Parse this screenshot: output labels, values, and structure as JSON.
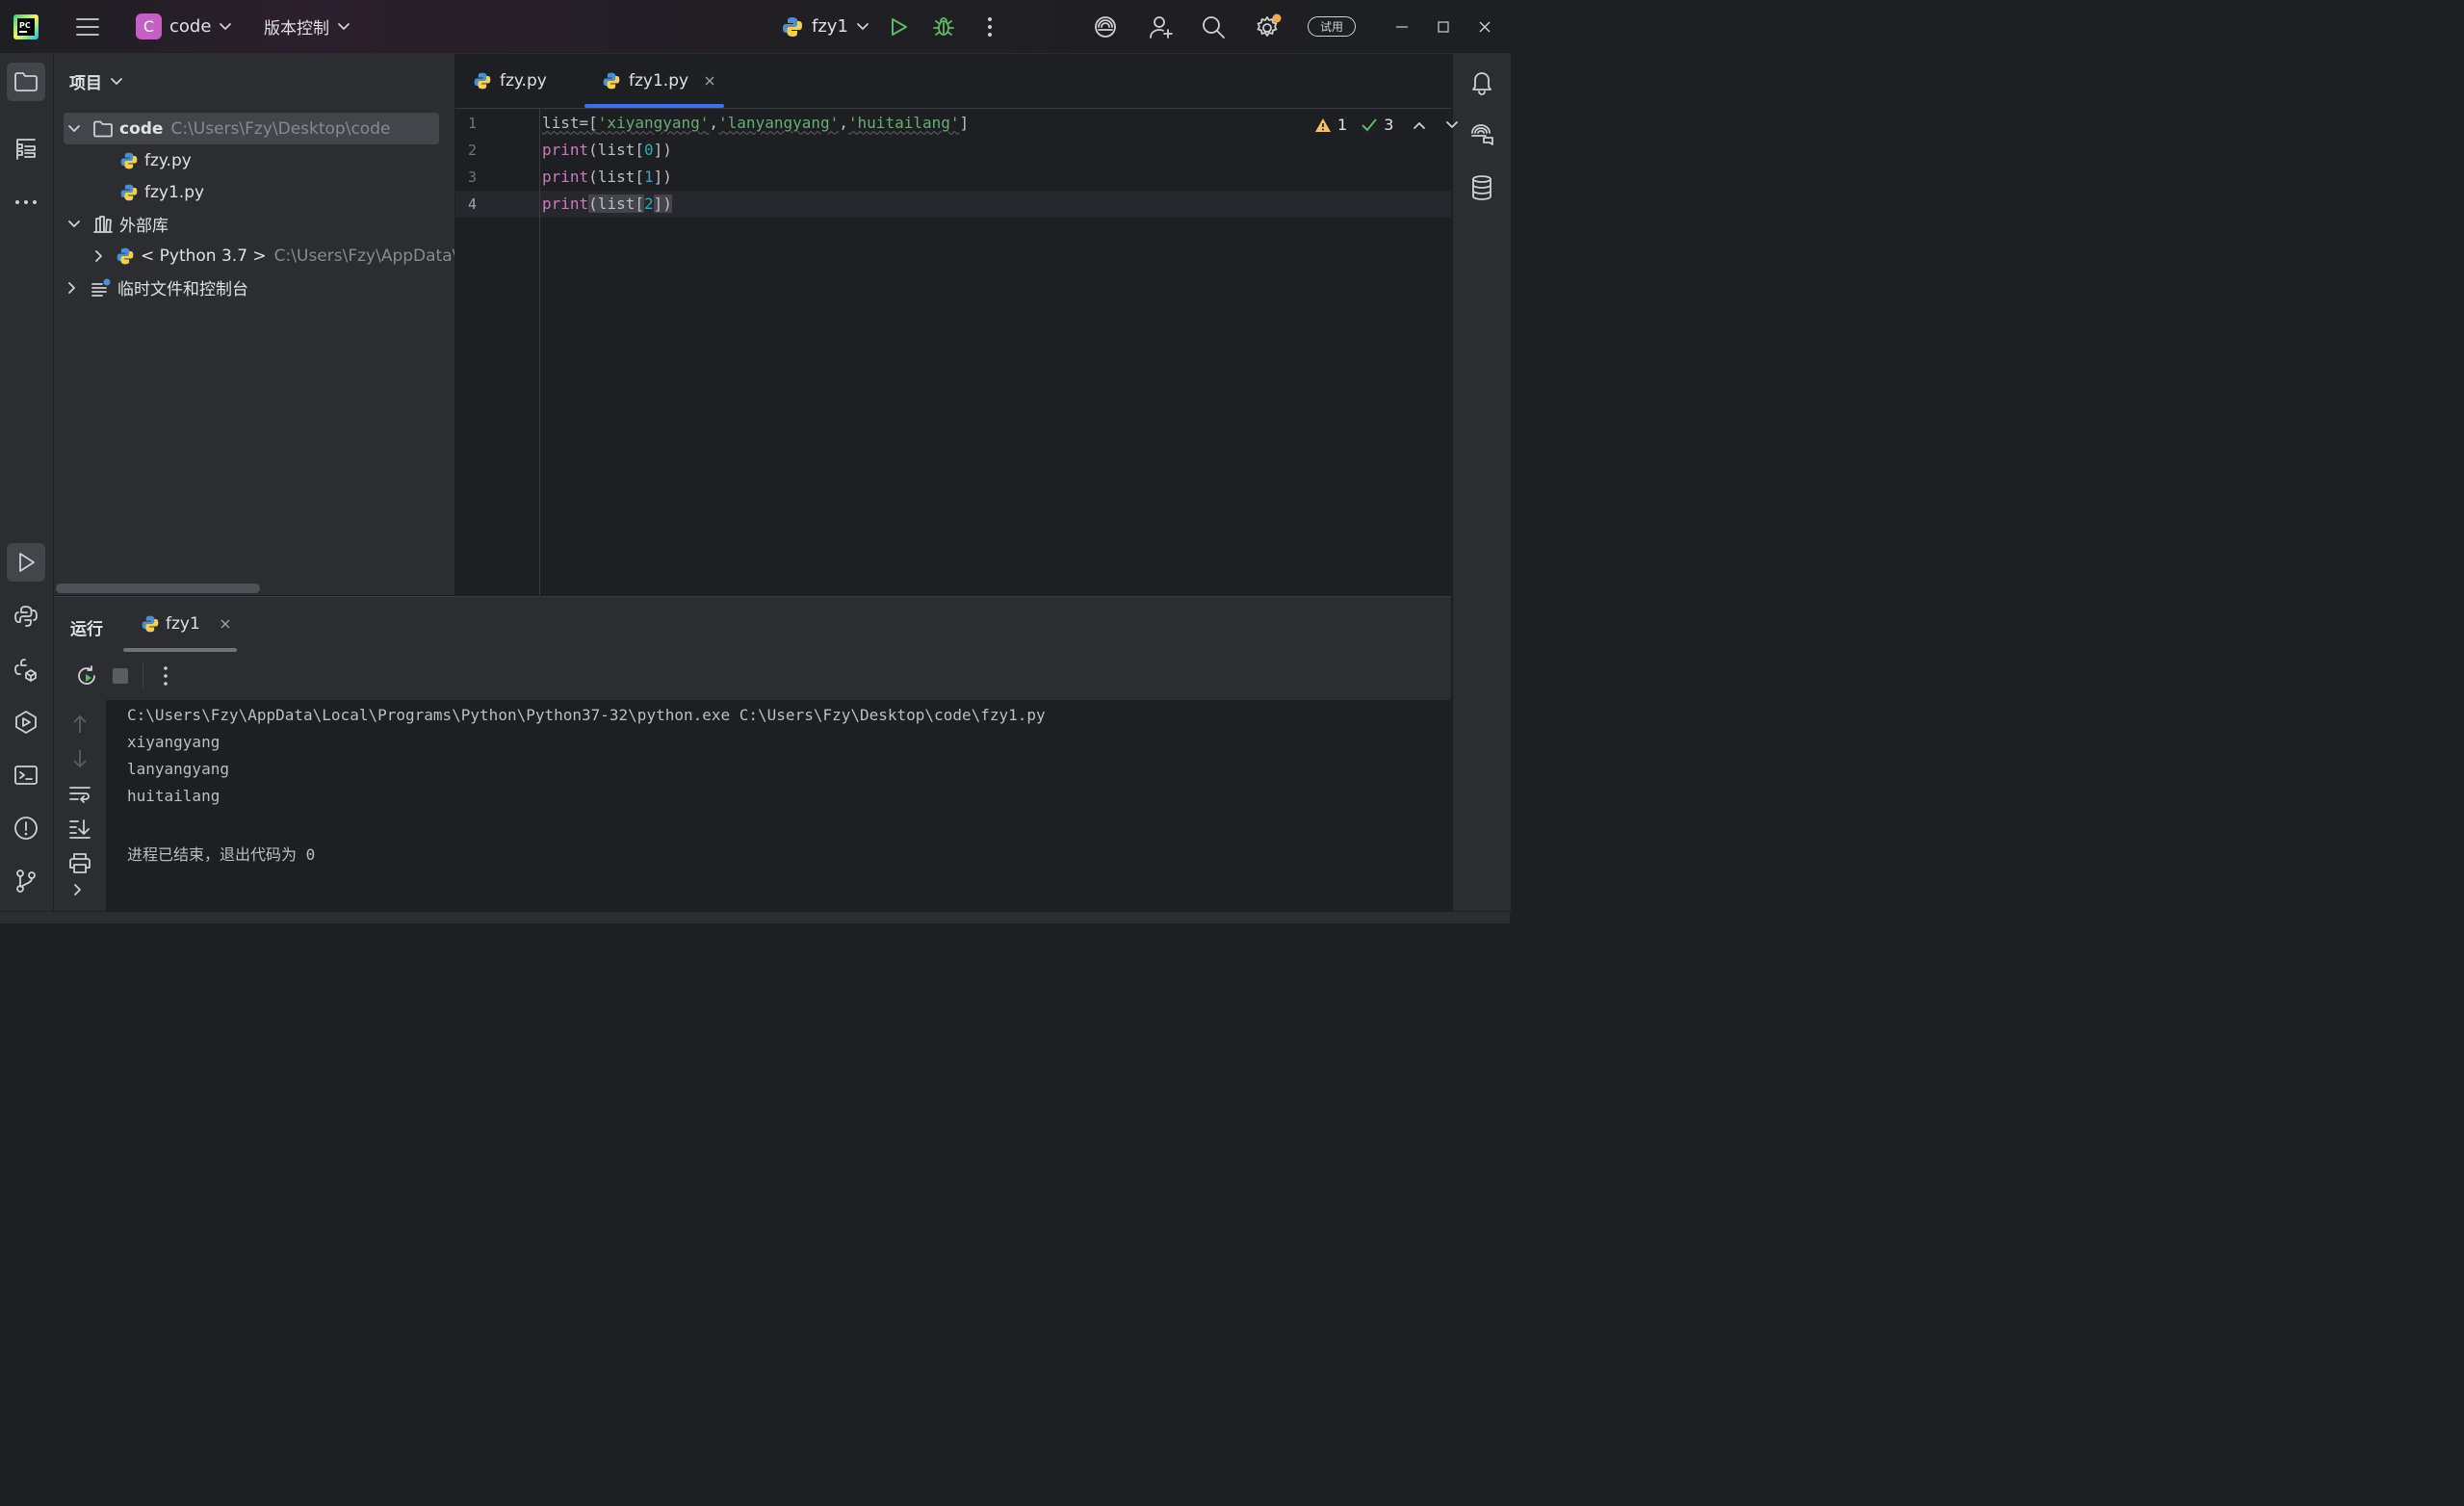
{
  "app": {
    "logo_text": "PC"
  },
  "titlebar": {
    "project_badge": "C",
    "project_name": "code",
    "vcs_label": "版本控制",
    "run_config": "fzy1",
    "trial_badge": "试用"
  },
  "project_panel": {
    "title": "项目",
    "root": {
      "name": "code",
      "path": "C:\\Users\\Fzy\\Desktop\\code"
    },
    "files": [
      "fzy.py",
      "fzy1.py"
    ],
    "external_libs": "外部库",
    "python_sdk": {
      "name": "< Python 3.7 >",
      "path": "C:\\Users\\Fzy\\AppData\\Lc"
    },
    "scratches": "临时文件和控制台"
  },
  "editor": {
    "tabs": [
      {
        "label": "fzy.py",
        "active": false
      },
      {
        "label": "fzy1.py",
        "active": true
      }
    ],
    "warnings": "1",
    "checks": "3",
    "line_numbers": [
      "1",
      "2",
      "3",
      "4"
    ],
    "code": {
      "line1": {
        "pre": "list=[",
        "s1": "'xiyangyang'",
        "c1": ",",
        "s2": "'lanyangyang'",
        "c2": ",",
        "s3": "'huitailang'",
        "post": "]"
      },
      "line2": {
        "fn": "print",
        "open": "(list[",
        "idx": "0",
        "close": "])"
      },
      "line3": {
        "fn": "print",
        "open": "(list[",
        "idx": "1",
        "close": "])"
      },
      "line4": {
        "fn": "print",
        "open": "(list[",
        "idx": "2",
        "close": "])"
      }
    }
  },
  "run_panel": {
    "title": "运行",
    "tab": "fzy1",
    "output": [
      "C:\\Users\\Fzy\\AppData\\Local\\Programs\\Python\\Python37-32\\python.exe C:\\Users\\Fzy\\Desktop\\code\\fzy1.py",
      "xiyangyang",
      "lanyangyang",
      "huitailang",
      "",
      "进程已结束，退出代码为 0"
    ]
  },
  "colors": {
    "accent": "#3574f0",
    "run_green": "#5fb865",
    "warning": "#f2c55c",
    "project_badge": "#c55fc3"
  },
  "icons": [
    "app-logo-icon",
    "hamburger-menu-icon",
    "chevron-down-icon",
    "python-icon",
    "run-icon",
    "debug-icon",
    "more-vertical-icon",
    "ai-spiral-icon",
    "add-user-icon",
    "search-icon",
    "gear-icon",
    "minimize-icon",
    "maximize-icon",
    "close-icon",
    "folder-icon",
    "structure-icon",
    "more-horizontal-icon",
    "bell-icon",
    "ai-chat-icon",
    "database-icon",
    "rerun-icon",
    "stop-icon",
    "arrow-up-icon",
    "arrow-down-icon",
    "soft-wrap-icon",
    "scroll-end-icon",
    "print-icon",
    "terminal-icon",
    "problems-icon",
    "git-branch-icon",
    "library-icon",
    "scratch-icon",
    "warning-icon",
    "check-icon"
  ]
}
